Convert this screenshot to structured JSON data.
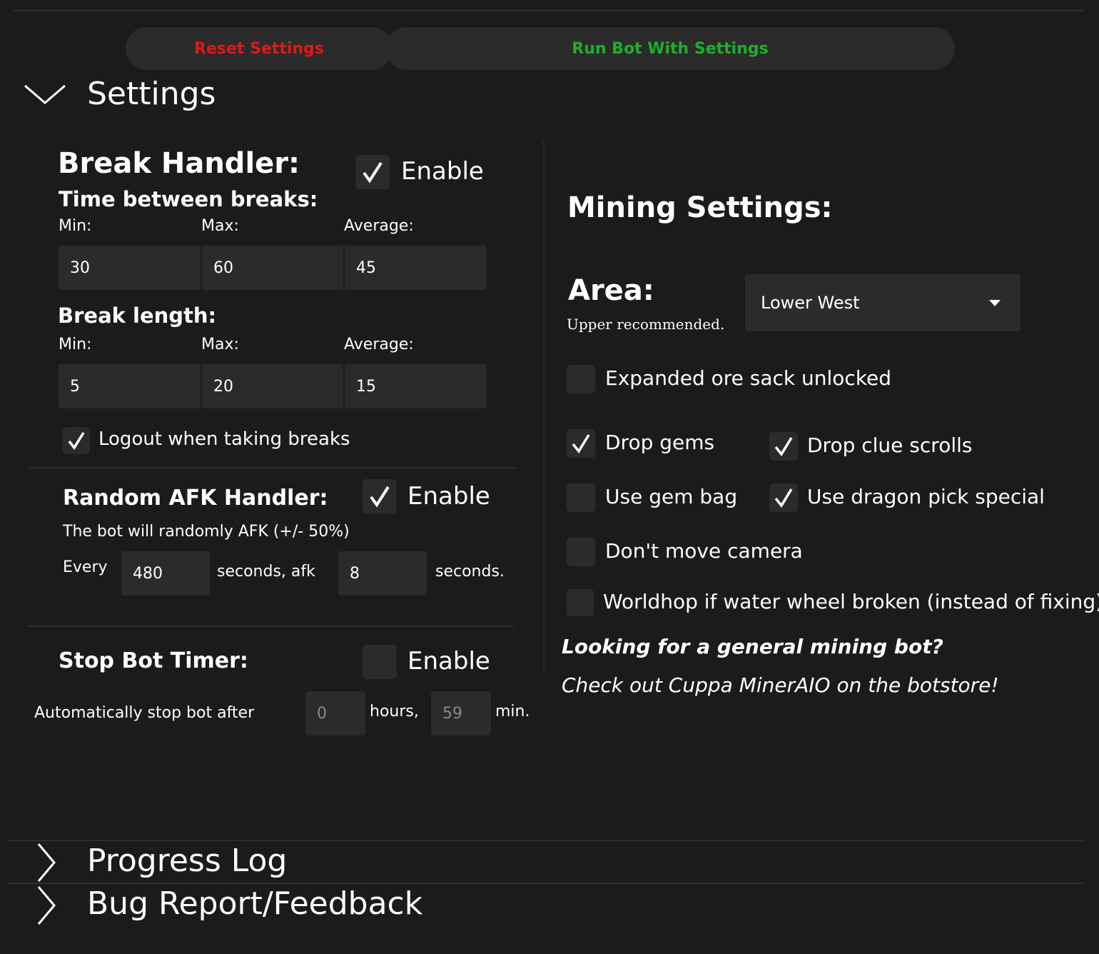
{
  "top_buttons": {
    "reset_label": "Reset Settings",
    "run_label": "Run Bot With Settings",
    "reset_color": "#e01818",
    "run_color": "#1fae2a"
  },
  "settings_section": {
    "title": "Settings",
    "expanded": true
  },
  "break_handler": {
    "title": "Break Handler:",
    "enable_label": "Enable",
    "enabled": true,
    "time_between_title": "Time between breaks:",
    "min_label": "Min:",
    "max_label": "Max:",
    "avg_label": "Average:",
    "time_min": "30",
    "time_max": "60",
    "time_avg": "45",
    "length_title": "Break length:",
    "length_min": "5",
    "length_max": "20",
    "length_avg": "15",
    "logout_label": "Logout when taking breaks",
    "logout_checked": true
  },
  "afk_handler": {
    "title": "Random AFK Handler:",
    "enable_label": "Enable",
    "enabled": true,
    "description": "The bot will randomly AFK (+/- 50%)",
    "every_label": "Every",
    "every_value": "480",
    "seconds_afk_label": "seconds, afk",
    "afk_value": "8",
    "seconds_label": "seconds."
  },
  "stop_timer": {
    "title": "Stop Bot Timer:",
    "enable_label": "Enable",
    "enabled": false,
    "auto_stop_label": "Automatically stop bot after",
    "hours_value": "0",
    "hours_label": "hours,",
    "minutes_value": "59",
    "minutes_label": "min."
  },
  "mining_settings": {
    "title": "Mining Settings:",
    "area_label": "Area:",
    "area_hint": "Upper recommended.",
    "area_selected": "Lower West",
    "expanded_sack_label": "Expanded ore sack unlocked",
    "expanded_sack_checked": false,
    "drop_gems_label": "Drop gems",
    "drop_gems_checked": true,
    "drop_clue_label": "Drop clue scrolls",
    "drop_clue_checked": true,
    "gem_bag_label": "Use gem bag",
    "gem_bag_checked": false,
    "dragon_pick_label": "Use dragon pick special",
    "dragon_pick_checked": true,
    "camera_label": "Don't move camera",
    "camera_checked": false,
    "worldhop_label": "Worldhop if water wheel broken (instead of fixing)",
    "worldhop_checked": false,
    "promo_question": "Looking for a general mining bot?",
    "promo_text": "Check out Cuppa MinerAIO on the botstore!"
  },
  "collapsed_sections": {
    "progress_log": "Progress Log",
    "bug_report": "Bug Report/Feedback"
  },
  "icons": {
    "expanded": "chevron-down-icon",
    "collapsed": "chevron-right-icon",
    "checked": "checkmark-icon",
    "dropdown": "caret-down-icon"
  }
}
